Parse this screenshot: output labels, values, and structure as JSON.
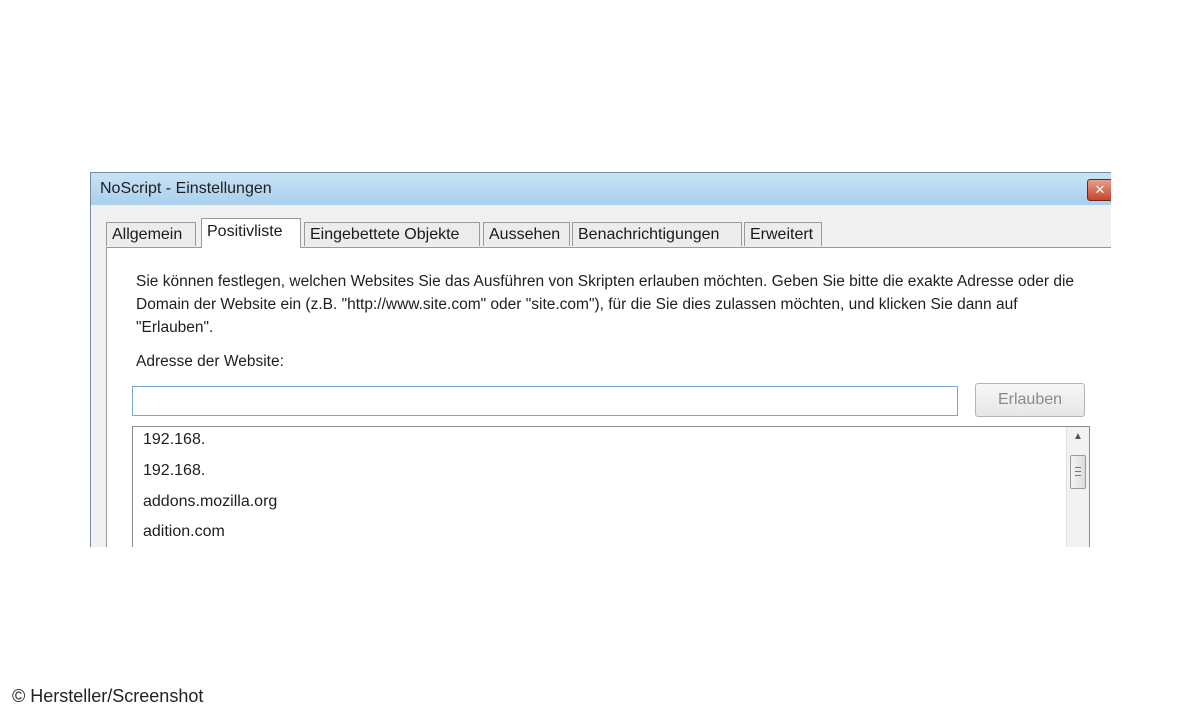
{
  "window": {
    "title": "NoScript - Einstellungen",
    "close_label": "✕"
  },
  "tabs": [
    {
      "label": "Allgemein",
      "active": false
    },
    {
      "label": "Positivliste",
      "active": true
    },
    {
      "label": "Eingebettete Objekte",
      "active": false
    },
    {
      "label": "Aussehen",
      "active": false
    },
    {
      "label": "Benachrichtigungen",
      "active": false
    },
    {
      "label": "Erweitert",
      "active": false
    }
  ],
  "panel": {
    "description": "Sie können festlegen, welchen Websites Sie das Ausführen von Skripten erlauben möchten. Geben Sie bitte die exakte Adresse oder die Domain der Website ein (z.B. \"http://www.site.com\" oder \"site.com\"), für die Sie dies zulassen möchten, und klicken Sie dann auf \"Erlauben\".",
    "address_label": "Adresse der Website:",
    "address_value": "",
    "allow_button": "Erlauben",
    "whitelist": [
      "192.168.",
      "192.168.",
      "addons.mozilla.org",
      "adition.com"
    ]
  },
  "credit": "© Hersteller/Screenshot"
}
